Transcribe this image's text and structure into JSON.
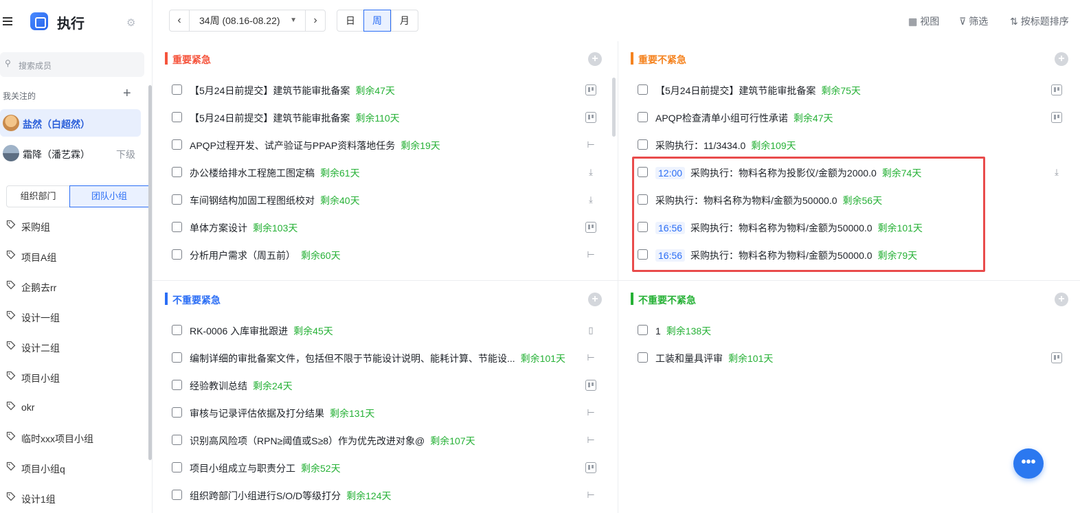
{
  "sidebar": {
    "app_title": "执行",
    "search_placeholder": "搜索成员",
    "follow_title": "我关注的",
    "people": [
      {
        "name": "盐然（白超然）",
        "tag": ""
      },
      {
        "name": "霜降（潘艺霖）",
        "tag": "下级"
      }
    ],
    "segments": [
      "组织部门",
      "团队小组"
    ],
    "groups": [
      "采购组",
      "项目A组",
      "企鹅去rr",
      "设计一组",
      "设计二组",
      "项目小组",
      "okr",
      "临时xxx项目小组",
      "项目小组q",
      "设计1组"
    ]
  },
  "toolbar": {
    "prev": "‹",
    "next": "›",
    "week": "34周 (08.16-08.22)",
    "modes": [
      "日",
      "周",
      "月"
    ],
    "view": "视图",
    "filter": "筛选",
    "sort": "按标题排序"
  },
  "quadrants": {
    "q1": {
      "title": "重要紧急",
      "color": "#f5543c",
      "tasks": [
        {
          "time": "",
          "text": "【5月24日前提交】建筑节能审批备案",
          "remain": "剩余47天",
          "icon": "kanban-icon"
        },
        {
          "time": "",
          "text": "【5月24日前提交】建筑节能审批备案",
          "remain": "剩余110天",
          "icon": "kanban-icon"
        },
        {
          "time": "",
          "text": "APQP过程开发、试产验证与PPAP资料落地任务",
          "remain": "剩余19天",
          "icon": "tree-icon"
        },
        {
          "time": "",
          "text": "办公楼给排水工程施工图定稿",
          "remain": "剩余61天",
          "icon": "inbox-icon"
        },
        {
          "time": "",
          "text": "车间钢结构加固工程图纸校对",
          "remain": "剩余40天",
          "icon": "inbox-icon"
        },
        {
          "time": "",
          "text": "单体方案设计",
          "remain": "剩余103天",
          "icon": "kanban-icon"
        },
        {
          "time": "",
          "text": "分析用户需求（周五前）",
          "remain": "剩余60天",
          "icon": "tree-icon"
        }
      ]
    },
    "q2": {
      "title": "重要不紧急",
      "color": "#f5831f",
      "tasks": [
        {
          "time": "",
          "text": "【5月24日前提交】建筑节能审批备案",
          "remain": "剩余75天",
          "icon": "kanban-icon"
        },
        {
          "time": "",
          "text": "APQP检查清单小组可行性承诺",
          "remain": "剩余47天",
          "icon": "kanban-icon"
        },
        {
          "time": "",
          "text": "采购执行：11/3434.0",
          "remain": "剩余109天",
          "icon": ""
        },
        {
          "time": "12:00",
          "text": "采购执行：物料名称为投影仪/金额为2000.0",
          "remain": "剩余74天",
          "icon": "inbox-icon"
        },
        {
          "time": "",
          "text": "采购执行：物料名称为物料/金额为50000.0",
          "remain": "剩余56天",
          "icon": ""
        },
        {
          "time": "16:56",
          "text": "采购执行：物料名称为物料/金额为50000.0",
          "remain": "剩余101天",
          "icon": ""
        },
        {
          "time": "16:56",
          "text": "采购执行：物料名称为物料/金额为50000.0",
          "remain": "剩余79天",
          "icon": ""
        }
      ]
    },
    "q3": {
      "title": "不重要紧急",
      "color": "#2b6ef5",
      "tasks": [
        {
          "time": "",
          "text": "RK-0006 入库审批跟进",
          "remain": "剩余45天",
          "icon": "doc-icon"
        },
        {
          "time": "",
          "text": "编制详细的审批备案文件，包括但不限于节能设计说明、能耗计算、节能设...",
          "remain": "剩余101天",
          "icon": "tree-icon"
        },
        {
          "time": "",
          "text": "经验教训总结",
          "remain": "剩余24天",
          "icon": "kanban-icon"
        },
        {
          "time": "",
          "text": "审核与记录评估依据及打分结果",
          "remain": "剩余131天",
          "icon": "tree-icon"
        },
        {
          "time": "",
          "text": "识别高风险项（RPN≥阈值或S≥8）作为优先改进对象@",
          "remain": "剩余107天",
          "icon": "tree-icon"
        },
        {
          "time": "",
          "text": "项目小组成立与职责分工",
          "remain": "剩余52天",
          "icon": "kanban-icon"
        },
        {
          "time": "",
          "text": "组织跨部门小组进行S/O/D等级打分",
          "remain": "剩余124天",
          "icon": "tree-icon"
        }
      ]
    },
    "q4": {
      "title": "不重要不紧急",
      "color": "#26b136",
      "tasks": [
        {
          "time": "",
          "text": "1",
          "remain": "剩余138天",
          "icon": ""
        },
        {
          "time": "",
          "text": "工装和量具评审",
          "remain": "剩余101天",
          "icon": "kanban-icon"
        }
      ]
    }
  },
  "fab": "•••"
}
